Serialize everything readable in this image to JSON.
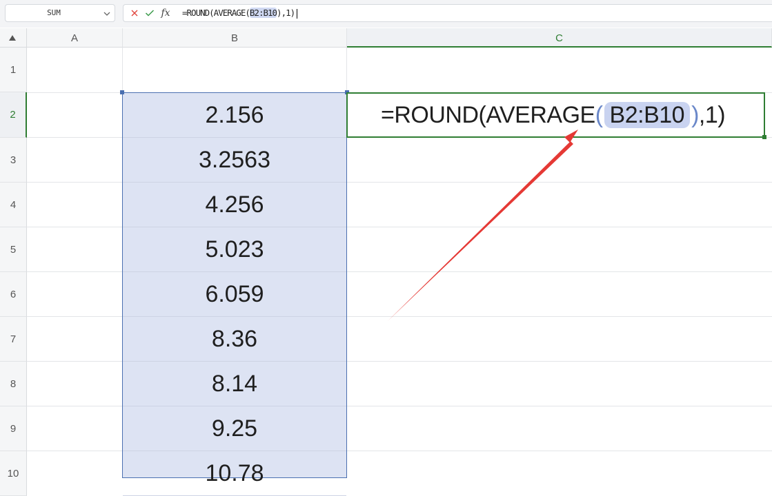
{
  "formula_bar": {
    "name_box": "SUM",
    "cancel_icon": "close-icon",
    "confirm_icon": "check-icon",
    "fx_label": "fx",
    "formula_prefix": "=ROUND(AVERAGE(",
    "formula_ref": "B2:B10",
    "formula_suffix": "),1)"
  },
  "columns": [
    "A",
    "B",
    "C"
  ],
  "rows": [
    "1",
    "2",
    "3",
    "4",
    "5",
    "6",
    "7",
    "8",
    "9",
    "10"
  ],
  "column_b": [
    "2.156",
    "3.2563",
    "4.256",
    "5.023",
    "6.059",
    "8.36",
    "8.14",
    "9.25",
    "10.78"
  ],
  "cell_c2": {
    "prefix": "=ROUND(AVERAGE",
    "open_paren": "(",
    "ref": "B2:B10",
    "close_paren": ")",
    "suffix": ",1)"
  },
  "colors": {
    "selection_fill": "#dde3f3",
    "selection_border": "#4a6fb0",
    "active_border": "#2e7d32",
    "annotation_arrow": "#e53935"
  }
}
